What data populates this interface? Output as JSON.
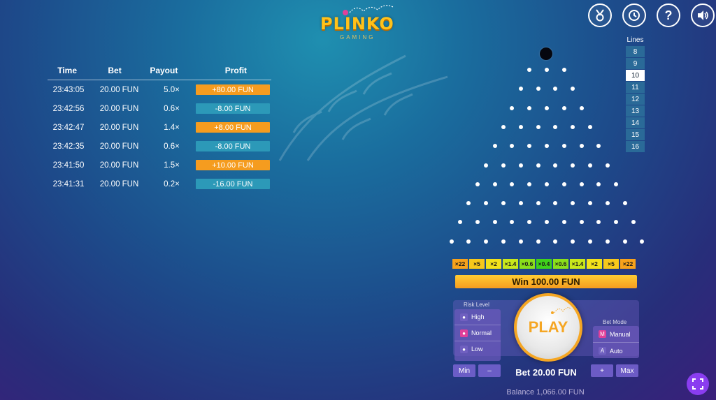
{
  "logo": {
    "title": "PLINKO",
    "subtitle": "GAMING"
  },
  "history": {
    "headers": {
      "time": "Time",
      "bet": "Bet",
      "payout": "Payout",
      "profit": "Profit"
    },
    "rows": [
      {
        "time": "23:43:05",
        "bet": "20.00 FUN",
        "payout": "5.0×",
        "profit": "+80.00 FUN",
        "kind": "win"
      },
      {
        "time": "23:42:56",
        "bet": "20.00 FUN",
        "payout": "0.6×",
        "profit": "-8.00 FUN",
        "kind": "loss"
      },
      {
        "time": "23:42:47",
        "bet": "20.00 FUN",
        "payout": "1.4×",
        "profit": "+8.00 FUN",
        "kind": "win"
      },
      {
        "time": "23:42:35",
        "bet": "20.00 FUN",
        "payout": "0.6×",
        "profit": "-8.00 FUN",
        "kind": "loss"
      },
      {
        "time": "23:41:50",
        "bet": "20.00 FUN",
        "payout": "1.5×",
        "profit": "+10.00 FUN",
        "kind": "win"
      },
      {
        "time": "23:41:31",
        "bet": "20.00 FUN",
        "payout": "0.2×",
        "profit": "-16.00 FUN",
        "kind": "loss"
      }
    ]
  },
  "lines": {
    "label": "Lines",
    "options": [
      "8",
      "9",
      "10",
      "11",
      "12",
      "13",
      "14",
      "15",
      "16"
    ],
    "selected": "10"
  },
  "board": {
    "rows": 10
  },
  "multipliers": [
    {
      "label": "×22",
      "color": "#f7a21b"
    },
    {
      "label": "×5",
      "color": "#f7c81b"
    },
    {
      "label": "×2",
      "color": "#f2e21b"
    },
    {
      "label": "×1.4",
      "color": "#c9e81b"
    },
    {
      "label": "×0.6",
      "color": "#8be01b"
    },
    {
      "label": "×0.4",
      "color": "#3fd21b"
    },
    {
      "label": "×0.6",
      "color": "#8be01b"
    },
    {
      "label": "×1.4",
      "color": "#c9e81b"
    },
    {
      "label": "×2",
      "color": "#f2e21b"
    },
    {
      "label": "×5",
      "color": "#f7c81b"
    },
    {
      "label": "×22",
      "color": "#f7a21b"
    }
  ],
  "win_banner": "Win 100.00 FUN",
  "risk": {
    "label": "Risk Level",
    "options": [
      {
        "label": "High",
        "icon": "fire-icon"
      },
      {
        "label": "Normal",
        "icon": "balance-icon",
        "active": true
      },
      {
        "label": "Low",
        "icon": "leaf-icon"
      }
    ]
  },
  "bet_mode": {
    "label": "Bet Mode",
    "options": [
      {
        "letter": "M",
        "label": "Manual",
        "active": true
      },
      {
        "letter": "A",
        "label": "Auto"
      }
    ]
  },
  "play_label": "PLAY",
  "controls": {
    "min": "Min",
    "minus": "–",
    "plus": "+",
    "max": "Max",
    "bet": "Bet 20.00 FUN",
    "balance": "Balance 1,066.00 FUN"
  },
  "colors": {
    "win": "#f59c1f",
    "loss": "#2c99b8",
    "accent": "#f5a623",
    "purple": "#8a3df0"
  }
}
